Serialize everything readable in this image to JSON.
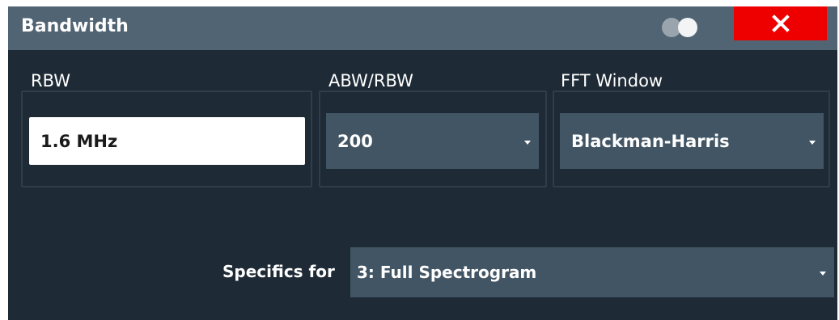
{
  "dialog": {
    "title": "Bandwidth",
    "icons": {
      "toggle": "toggle-icon",
      "close": "close-icon"
    },
    "colors": {
      "close_button": "#ef0000",
      "title_bar": "#516473",
      "background": "#1e2a35",
      "dropdown": "#425564"
    }
  },
  "rbw": {
    "label": "RBW",
    "value": "1.6 MHz"
  },
  "abw_rbw": {
    "label": "ABW/RBW",
    "value": "200"
  },
  "fft_window": {
    "label": "FFT Window",
    "value": "Blackman-Harris"
  },
  "specifics": {
    "label": "Specifics for",
    "value": "3: Full Spectrogram"
  }
}
